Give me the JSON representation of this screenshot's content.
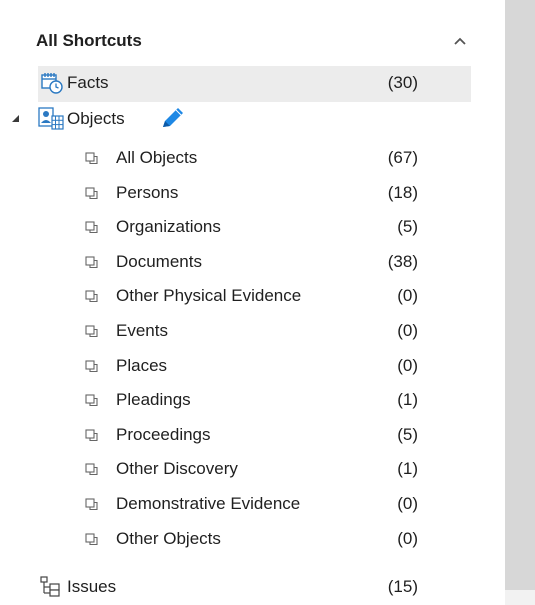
{
  "header": {
    "title": "All Shortcuts"
  },
  "tree": {
    "facts": {
      "label": "Facts",
      "count": "(30)"
    },
    "objects": {
      "label": "Objects"
    },
    "children": [
      {
        "label": "All Objects",
        "count": "(67)"
      },
      {
        "label": "Persons",
        "count": "(18)"
      },
      {
        "label": "Organizations",
        "count": "(5)"
      },
      {
        "label": "Documents",
        "count": "(38)"
      },
      {
        "label": "Other Physical Evidence",
        "count": "(0)"
      },
      {
        "label": "Events",
        "count": "(0)"
      },
      {
        "label": "Places",
        "count": "(0)"
      },
      {
        "label": "Pleadings",
        "count": "(1)"
      },
      {
        "label": "Proceedings",
        "count": "(5)"
      },
      {
        "label": "Other Discovery",
        "count": "(1)"
      },
      {
        "label": "Demonstrative Evidence",
        "count": "(0)"
      },
      {
        "label": "Other Objects",
        "count": "(0)"
      }
    ],
    "issues": {
      "label": "Issues",
      "count": "(15)"
    }
  },
  "icons": {
    "collapse": "chevron-up-icon",
    "facts": "calendar-clock-icon",
    "objects": "objects-person-grid-icon",
    "edit": "pencil-icon",
    "child": "shortcut-node-icon",
    "issues": "issues-hierarchy-icon"
  },
  "colors": {
    "selected_row": "#ececec",
    "scrollbar": "#d7d7d7",
    "pencil": "#1e88e5",
    "icon_blue": "#2b79c2"
  }
}
